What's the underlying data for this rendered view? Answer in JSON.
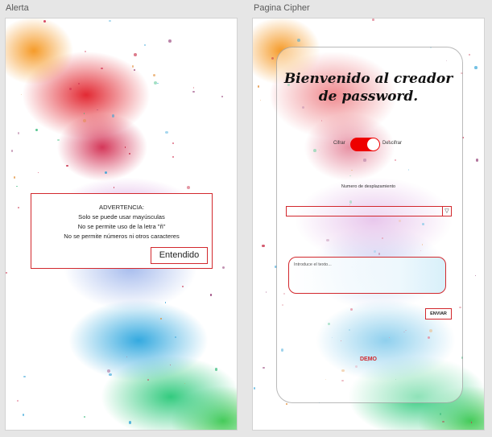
{
  "artboards": {
    "alerta": {
      "label": "Alerta"
    },
    "cipher": {
      "label": "Pagina Cipher"
    }
  },
  "alert": {
    "lines": [
      "ADVERTENCIA:",
      "Solo se puede usar mayúsculas",
      "No se permite uso de la letra \"ñ\"",
      "No se permite números ni otros caracteres"
    ],
    "button_label": "Entendido"
  },
  "cipher": {
    "title_lines": [
      "Bienvenido al creador",
      "de password."
    ],
    "toggle": {
      "left_label": "Cifrar",
      "right_label": "Descifrar",
      "on": true
    },
    "shift_label": "Numero de desplazamiento",
    "shift_value": "",
    "text_placeholder": "Introduce el texto...",
    "send_label": "ENVIAR",
    "demo_label": "DEMO"
  },
  "colors": {
    "accent": "#d2282d",
    "toggle_on": "#ee0000",
    "canvas_bg": "#e6e6e6"
  },
  "icons": {
    "select_arrow": "triangle-down-icon"
  }
}
